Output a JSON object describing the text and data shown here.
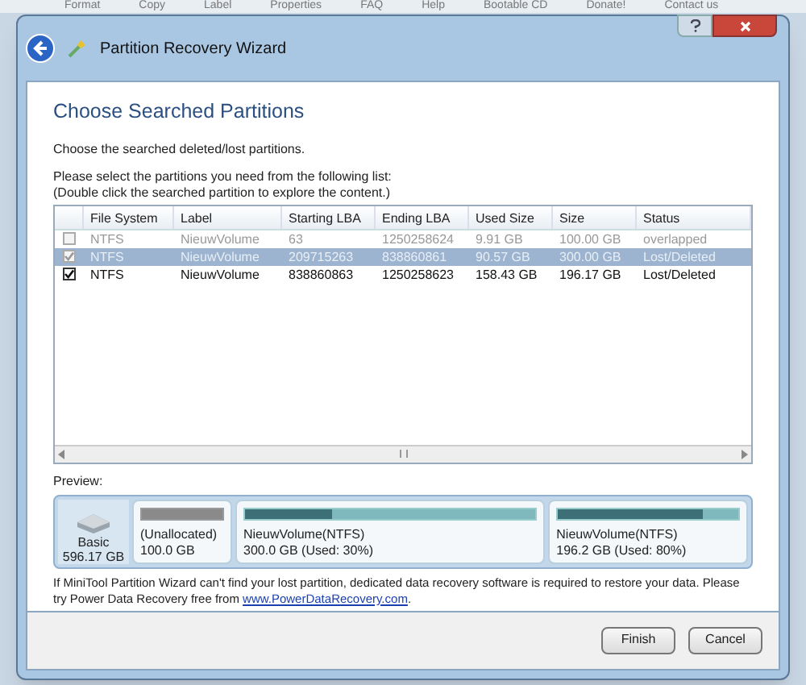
{
  "background_toolbar": [
    "Format",
    "Copy",
    "Label",
    "Properties",
    "FAQ",
    "Help",
    "Bootable CD",
    "Donate!",
    "Contact us"
  ],
  "window": {
    "title": "Partition Recovery Wizard"
  },
  "heading": "Choose Searched Partitions",
  "intro": "Choose the searched deleted/lost partitions.",
  "instructions": [
    "Please select the partitions you need from the following list:",
    "(Double click the searched partition to explore the content.)"
  ],
  "table": {
    "columns": [
      "File System",
      "Label",
      "Starting LBA",
      "Ending LBA",
      "Used Size",
      "Size",
      "Status"
    ],
    "rows": [
      {
        "checked": false,
        "selected": false,
        "disabled": true,
        "cells": [
          "NTFS",
          "NieuwVolume",
          "63",
          "1250258624",
          "9.91 GB",
          "100.00 GB",
          "overlapped"
        ]
      },
      {
        "checked": true,
        "selected": true,
        "disabled": true,
        "cells": [
          "NTFS",
          "NieuwVolume",
          "209715263",
          "838860861",
          "90.57 GB",
          "300.00 GB",
          "Lost/Deleted"
        ]
      },
      {
        "checked": true,
        "selected": false,
        "disabled": false,
        "cells": [
          "NTFS",
          "NieuwVolume",
          "838860863",
          "1250258623",
          "158.43 GB",
          "196.17 GB",
          "Lost/Deleted"
        ]
      }
    ]
  },
  "preview": {
    "label": "Preview:",
    "disk": {
      "type": "Basic",
      "size": "596.17 GB"
    },
    "segments": [
      {
        "kind": "unallocated",
        "name": "(Unallocated)",
        "detail": "100.0 GB"
      },
      {
        "kind": "partition",
        "name": "NieuwVolume(NTFS)",
        "detail": "300.0 GB (Used: 30%)",
        "level": 0.3
      },
      {
        "kind": "partition",
        "name": "NieuwVolume(NTFS)",
        "detail": "196.2 GB (Used: 80%)",
        "level": 0.8
      }
    ]
  },
  "note": {
    "text": "If MiniTool Partition Wizard can't find your lost partition, dedicated data recovery software is required to restore your data. Please try Power Data Recovery free from ",
    "link": "www.PowerDataRecovery.com",
    "after": "."
  },
  "buttons": [
    "Finish",
    "Cancel"
  ]
}
